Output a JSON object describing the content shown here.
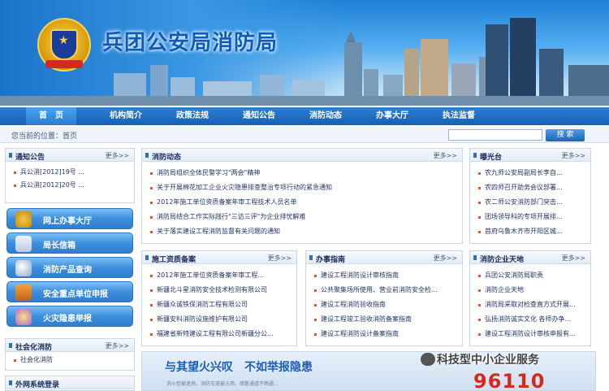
{
  "header": {
    "title": "兵团公安局消防局"
  },
  "nav": {
    "items": [
      "首　页",
      "机构简介",
      "政策法规",
      "通知公告",
      "消防动态",
      "办事大厅",
      "执法监督"
    ]
  },
  "location": {
    "text": "您当前的位置：首页"
  },
  "search": {
    "placeholder": "",
    "button_label": "搜 索"
  },
  "notice": {
    "title": "通知公告",
    "more": "更多>>",
    "items": [
      "兵公消[2012]19号 ...",
      "兵公消[2012]20号 ..."
    ]
  },
  "services": [
    "网上办事大厅",
    "局长信箱",
    "消防产品查询",
    "安全重点单位申报",
    "火灾隐患举报"
  ],
  "social": {
    "title": "社会化消防",
    "more": "更多>>",
    "items": [
      "社会化消防"
    ]
  },
  "extranet": {
    "title": "外网系统登录"
  },
  "fire_news": {
    "title": "消防动态",
    "more": "更多>>",
    "items": [
      "消防局组织全体民警学习\"两会\"精神",
      "关于开展棉花加工企业火灾隐患排查整治专项行动的紧急通知",
      "2012年施工单位资质备案年审工程技术人员名单",
      "消防局结合工作实际践行\"三访三评\"为企业排忧解难",
      "关于落实建设工程消防监督有关问题的通知"
    ]
  },
  "exposure": {
    "title": "曝光台",
    "more": "更多>>",
    "items": [
      "农九师公安局副局长李自...",
      "农四师召开助务会议部署...",
      "农二师公安消防部门突击...",
      "团场领导科的专项开展排...",
      "首府乌鲁木齐市开阳区城..."
    ]
  },
  "contractors": {
    "title": "施工资质备案",
    "more": "更多>>",
    "items": [
      "2012年施工单位资质备案年审工程...",
      "新疆北斗星消防安全技术检测有限公司",
      "新疆众诚铁保消防工程有限公司",
      "新疆安科消防设施维护有限公司",
      "福建省新特建设工程有限公司新疆分公..."
    ]
  },
  "guide": {
    "title": "办事指南",
    "more": "更多>>",
    "items": [
      "建设工程消防设计审核指南",
      "公共聚集场所使用、营业前消防安全检...",
      "建设工程消防验收指南",
      "建设工程竣工验收消防备案指南",
      "建设工程消防设计备案指南"
    ]
  },
  "companies": {
    "title": "消防企业天地",
    "more": "更多>>",
    "items": [
      "兵团公安消防局职责",
      "消防企业天地",
      "消防局采取对检查直方式开展...",
      "弘扬消防诚实文化 各师办争...",
      "建设工程消防设计审核申报有..."
    ]
  },
  "bottom_banner": {
    "slogan": "与其望火兴叹　不如举报隐患",
    "sub": "消火栓被遮挡，消防车道被占用，疏散通道不畅通...",
    "number": "96110"
  },
  "watermark": {
    "text": "科技型中小企业服务"
  },
  "colors": {
    "nav": "#1660b6",
    "accent": "#2a6fc4",
    "hotline": "#d22b1d"
  }
}
